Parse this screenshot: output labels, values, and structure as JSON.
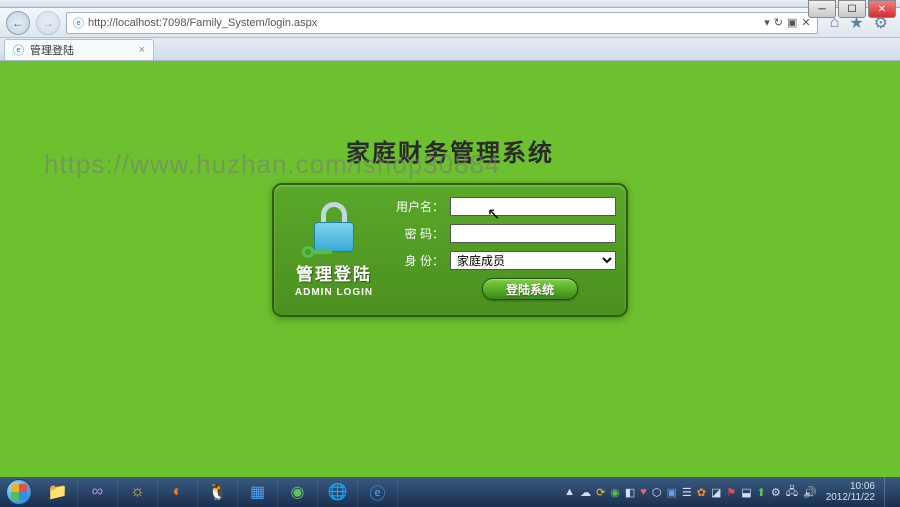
{
  "browser": {
    "url": "http://localhost:7098/Family_System/login.aspx",
    "tab_title": "管理登陆"
  },
  "page": {
    "title": "家庭财务管理系统",
    "watermark": "https://www.huzhan.com/ishop30884"
  },
  "login": {
    "left_title": "管理登陆",
    "left_sub": "ADMIN LOGIN",
    "username_label": "用户名：",
    "username_value": "",
    "password_label": "密  码：",
    "password_value": "",
    "role_label": "身  份：",
    "role_selected": "家庭成员",
    "submit_label": "登陆系统"
  },
  "taskbar": {
    "time": "10:06",
    "date": "2012/11/22"
  }
}
